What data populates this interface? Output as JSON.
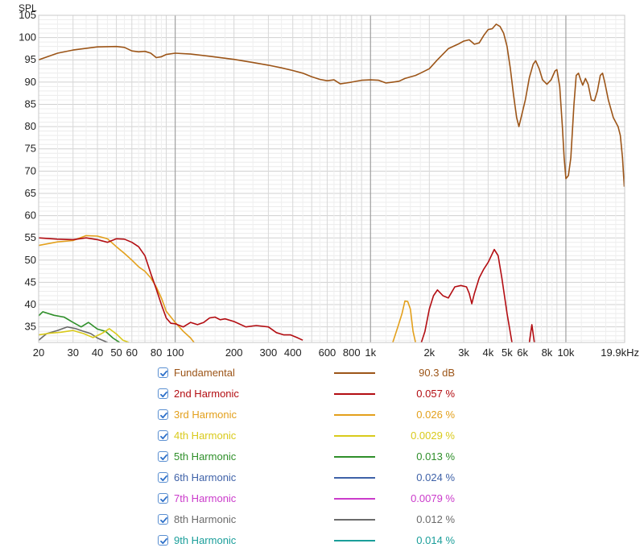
{
  "chart_data": {
    "type": "line",
    "ylabel": "SPL",
    "x_scale": "log",
    "xlim": [
      20,
      20000
    ],
    "ylim": [
      31.5,
      105
    ],
    "y_ticks": [
      "35",
      "40",
      "45",
      "50",
      "55",
      "60",
      "65",
      "70",
      "75",
      "80",
      "85",
      "90",
      "95",
      "100",
      "105"
    ],
    "x_tick_labels": [
      {
        "v": 20,
        "label": "20"
      },
      {
        "v": 30,
        "label": "30"
      },
      {
        "v": 40,
        "label": "40"
      },
      {
        "v": 50,
        "label": "50"
      },
      {
        "v": 60,
        "label": "60"
      },
      {
        "v": 80,
        "label": "80"
      },
      {
        "v": 100,
        "label": "100"
      },
      {
        "v": 200,
        "label": "200"
      },
      {
        "v": 300,
        "label": "300"
      },
      {
        "v": 400,
        "label": "400"
      },
      {
        "v": 600,
        "label": "600"
      },
      {
        "v": 800,
        "label": "800"
      },
      {
        "v": 1000,
        "label": "1k"
      },
      {
        "v": 2000,
        "label": "2k"
      },
      {
        "v": 3000,
        "label": "3k"
      },
      {
        "v": 4000,
        "label": "4k"
      },
      {
        "v": 5000,
        "label": "5k"
      },
      {
        "v": 6000,
        "label": "6k"
      },
      {
        "v": 8000,
        "label": "8k"
      },
      {
        "v": 10000,
        "label": "10k"
      },
      {
        "v": 20000,
        "label": "19.9kHz"
      }
    ],
    "grid": true,
    "series": [
      {
        "name": "Fundamental",
        "color": "#9c5518",
        "value": "90.3 dB",
        "points": [
          [
            20,
            95
          ],
          [
            25,
            96.5
          ],
          [
            30,
            97.2
          ],
          [
            40,
            97.9
          ],
          [
            50,
            98
          ],
          [
            55,
            97.8
          ],
          [
            60,
            97
          ],
          [
            65,
            96.8
          ],
          [
            70,
            96.9
          ],
          [
            75,
            96.5
          ],
          [
            80,
            95.5
          ],
          [
            85,
            95.7
          ],
          [
            90,
            96.2
          ],
          [
            100,
            96.5
          ],
          [
            120,
            96.3
          ],
          [
            150,
            95.8
          ],
          [
            200,
            95.1
          ],
          [
            250,
            94.4
          ],
          [
            300,
            93.8
          ],
          [
            350,
            93.2
          ],
          [
            400,
            92.6
          ],
          [
            450,
            92
          ],
          [
            500,
            91.2
          ],
          [
            550,
            90.6
          ],
          [
            600,
            90.3
          ],
          [
            650,
            90.5
          ],
          [
            700,
            89.6
          ],
          [
            750,
            89.8
          ],
          [
            800,
            90
          ],
          [
            900,
            90.4
          ],
          [
            1000,
            90.5
          ],
          [
            1100,
            90.4
          ],
          [
            1200,
            89.8
          ],
          [
            1300,
            90
          ],
          [
            1400,
            90.2
          ],
          [
            1500,
            90.8
          ],
          [
            1700,
            91.5
          ],
          [
            1800,
            92
          ],
          [
            2000,
            93
          ],
          [
            2200,
            95
          ],
          [
            2500,
            97.5
          ],
          [
            2800,
            98.5
          ],
          [
            3000,
            99.2
          ],
          [
            3200,
            99.5
          ],
          [
            3400,
            98.5
          ],
          [
            3600,
            98.8
          ],
          [
            3800,
            100.5
          ],
          [
            4000,
            101.8
          ],
          [
            4200,
            102
          ],
          [
            4400,
            103
          ],
          [
            4600,
            102.5
          ],
          [
            4800,
            101
          ],
          [
            5000,
            98
          ],
          [
            5200,
            93
          ],
          [
            5400,
            87
          ],
          [
            5600,
            82
          ],
          [
            5750,
            80
          ],
          [
            5900,
            82
          ],
          [
            6200,
            86
          ],
          [
            6500,
            91
          ],
          [
            6800,
            94
          ],
          [
            7000,
            94.8
          ],
          [
            7300,
            93
          ],
          [
            7600,
            90.5
          ],
          [
            8000,
            89.5
          ],
          [
            8400,
            90.5
          ],
          [
            8800,
            92.5
          ],
          [
            9000,
            92.8
          ],
          [
            9300,
            89
          ],
          [
            9600,
            80
          ],
          [
            9800,
            73
          ],
          [
            10000,
            68.3
          ],
          [
            10300,
            69
          ],
          [
            10600,
            73
          ],
          [
            11000,
            85
          ],
          [
            11300,
            91.5
          ],
          [
            11600,
            92
          ],
          [
            11900,
            90.5
          ],
          [
            12200,
            89.3
          ],
          [
            12600,
            90.8
          ],
          [
            13000,
            89.5
          ],
          [
            13500,
            86
          ],
          [
            14000,
            85.8
          ],
          [
            14500,
            88
          ],
          [
            15000,
            91.5
          ],
          [
            15400,
            92
          ],
          [
            15800,
            90
          ],
          [
            16500,
            86
          ],
          [
            17500,
            82
          ],
          [
            18500,
            80
          ],
          [
            19000,
            78
          ],
          [
            19500,
            73
          ],
          [
            19900,
            66.5
          ]
        ]
      },
      {
        "name": "2nd Harmonic",
        "color": "#b30d12",
        "value": "0.057 %",
        "points": [
          [
            20,
            55
          ],
          [
            25,
            54.7
          ],
          [
            30,
            54.6
          ],
          [
            35,
            55
          ],
          [
            40,
            54.6
          ],
          [
            45,
            54
          ],
          [
            50,
            54.8
          ],
          [
            55,
            54.7
          ],
          [
            60,
            54
          ],
          [
            65,
            53
          ],
          [
            70,
            51
          ],
          [
            75,
            47
          ],
          [
            80,
            43.5
          ],
          [
            85,
            40
          ],
          [
            90,
            37
          ],
          [
            95,
            35.8
          ],
          [
            100,
            35.7
          ],
          [
            110,
            35
          ],
          [
            120,
            36
          ],
          [
            130,
            35.5
          ],
          [
            140,
            36
          ],
          [
            150,
            37
          ],
          [
            160,
            37.2
          ],
          [
            170,
            36.6
          ],
          [
            180,
            36.8
          ],
          [
            200,
            36.2
          ],
          [
            230,
            35
          ],
          [
            260,
            35.3
          ],
          [
            300,
            35
          ],
          [
            330,
            33.7
          ],
          [
            360,
            33.2
          ],
          [
            390,
            33.2
          ],
          [
            420,
            32.6
          ],
          [
            450,
            32
          ],
          [
            "gap",
            "gap"
          ],
          [
            1820,
            31.5
          ],
          [
            1900,
            34
          ],
          [
            2000,
            39
          ],
          [
            2100,
            42
          ],
          [
            2200,
            43.3
          ],
          [
            2350,
            42
          ],
          [
            2500,
            41.5
          ],
          [
            2700,
            44
          ],
          [
            2900,
            44.3
          ],
          [
            3100,
            44
          ],
          [
            3200,
            42.5
          ],
          [
            3300,
            40.2
          ],
          [
            3400,
            42.5
          ],
          [
            3600,
            46
          ],
          [
            3800,
            48
          ],
          [
            4000,
            49.5
          ],
          [
            4300,
            52.4
          ],
          [
            4500,
            51
          ],
          [
            4700,
            46
          ],
          [
            5000,
            38
          ],
          [
            5300,
            31.5
          ],
          [
            "gap",
            "gap"
          ],
          [
            6500,
            31.5
          ],
          [
            6700,
            35.5
          ],
          [
            6900,
            31.5
          ]
        ]
      },
      {
        "name": "3rd Harmonic",
        "color": "#e3a01c",
        "value": "0.026 %",
        "points": [
          [
            20,
            53.3
          ],
          [
            25,
            54.1
          ],
          [
            30,
            54.4
          ],
          [
            35,
            55.5
          ],
          [
            40,
            55.4
          ],
          [
            45,
            54.8
          ],
          [
            50,
            53
          ],
          [
            55,
            51.5
          ],
          [
            60,
            50
          ],
          [
            65,
            48.5
          ],
          [
            70,
            47.5
          ],
          [
            75,
            46
          ],
          [
            80,
            44
          ],
          [
            85,
            41.5
          ],
          [
            90,
            38.5
          ],
          [
            100,
            36
          ],
          [
            110,
            34
          ],
          [
            120,
            32.5
          ],
          [
            125,
            31.5
          ],
          [
            "gap",
            "gap"
          ],
          [
            1300,
            31.5
          ],
          [
            1380,
            35
          ],
          [
            1450,
            38
          ],
          [
            1500,
            40.8
          ],
          [
            1550,
            40.7
          ],
          [
            1600,
            39
          ],
          [
            1650,
            34
          ],
          [
            1700,
            31.5
          ]
        ]
      },
      {
        "name": "4th Harmonic",
        "color": "#d9ca1b",
        "value": "0.0029 %",
        "points": [
          [
            20,
            33.2
          ],
          [
            23,
            33.6
          ],
          [
            26,
            33.8
          ],
          [
            30,
            34.2
          ],
          [
            34,
            33.5
          ],
          [
            38,
            32.6
          ],
          [
            42,
            33.5
          ],
          [
            46,
            34.6
          ],
          [
            50,
            33.4
          ],
          [
            54,
            32
          ],
          [
            58,
            31.5
          ]
        ]
      },
      {
        "name": "5th Harmonic",
        "color": "#2f8f2a",
        "value": "0.013 %",
        "points": [
          [
            20,
            37.5
          ],
          [
            21,
            38.4
          ],
          [
            24,
            37.6
          ],
          [
            27,
            37.2
          ],
          [
            30,
            36
          ],
          [
            33,
            35
          ],
          [
            36,
            36
          ],
          [
            40,
            34.5
          ],
          [
            44,
            34
          ],
          [
            48,
            32.5
          ],
          [
            52,
            31.5
          ]
        ]
      },
      {
        "name": "6th Harmonic",
        "color": "#3f62a8",
        "value": "0.024 %",
        "points": []
      },
      {
        "name": "7th Harmonic",
        "color": "#cb3bcb",
        "value": "0.0079 %",
        "points": []
      },
      {
        "name": "8th Harmonic",
        "color": "#6b6b6b",
        "value": "0.012 %",
        "points": [
          [
            20,
            32
          ],
          [
            22,
            33.5
          ],
          [
            25,
            34.2
          ],
          [
            28,
            35
          ],
          [
            31,
            34.6
          ],
          [
            34,
            34
          ],
          [
            37,
            33.5
          ],
          [
            40,
            32.5
          ],
          [
            45,
            31.5
          ]
        ]
      },
      {
        "name": "9th Harmonic",
        "color": "#1a9e9a",
        "value": "0.014 %",
        "points": []
      }
    ]
  }
}
